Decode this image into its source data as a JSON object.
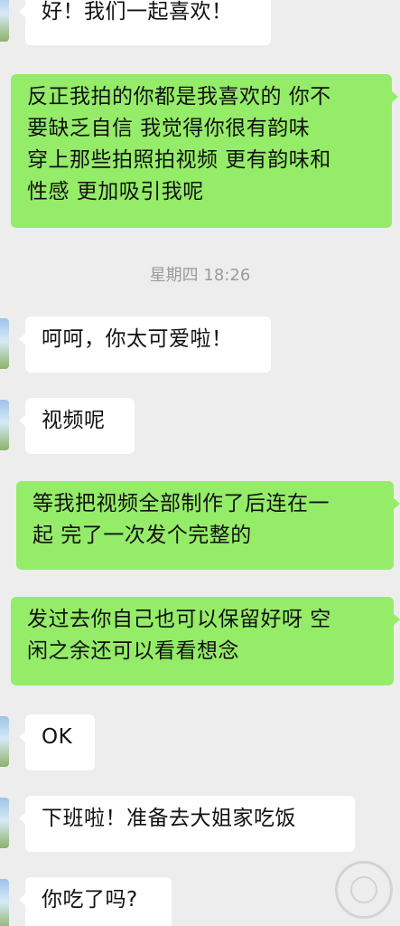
{
  "messages": [
    {
      "side": "in",
      "text": "好！我们一起喜欢！"
    },
    {
      "side": "out",
      "text": "反正我拍的你都是我喜欢的 你不\n要缺乏自信 我觉得你很有韵味\n穿上那些拍照拍视频 更有韵味和\n性感 更加吸引我呢"
    },
    {
      "side": "in",
      "text": "呵呵，你太可爱啦！"
    },
    {
      "side": "in",
      "text": "视频呢"
    },
    {
      "side": "out",
      "text": "等我把视频全部制作了后连在一\n起 完了一次发个完整的"
    },
    {
      "side": "out",
      "text": "发过去你自己也可以保留好呀 空\n闲之余还可以看看想念"
    },
    {
      "side": "in",
      "text": "OK"
    },
    {
      "side": "in",
      "text": "下班啦！准备去大姐家吃饭"
    },
    {
      "side": "in",
      "text": "你吃了吗?"
    }
  ],
  "timestamp": "星期四 18:26",
  "colors": {
    "background": "#ededed",
    "outgoing_bubble": "#95ec69",
    "incoming_bubble": "#ffffff",
    "timestamp_text": "#9b9b9b"
  }
}
